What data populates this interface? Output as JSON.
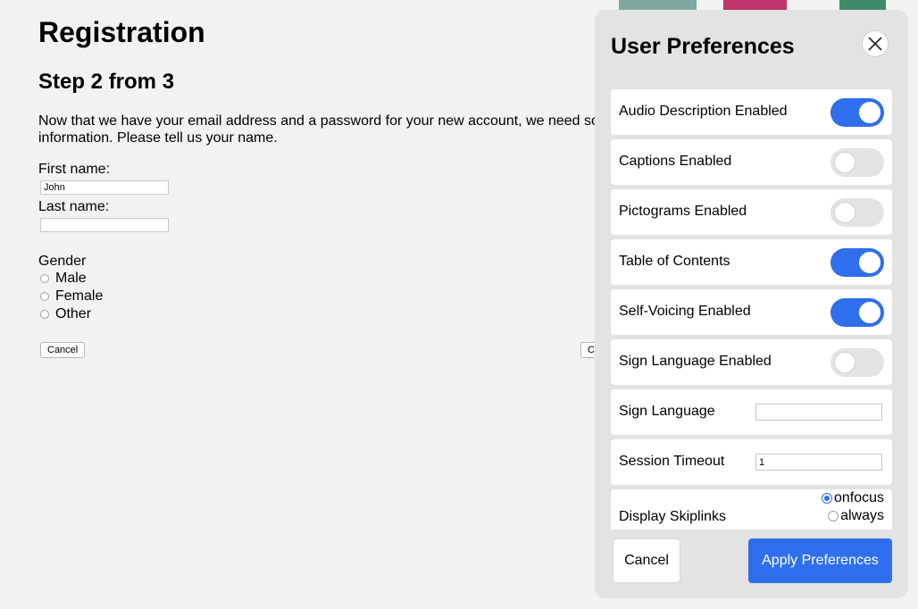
{
  "registration": {
    "title": "Registration",
    "step": "Step 2 from 3",
    "intro_line1": "Now that we have your email address and a password for your new account, we need so",
    "intro_line2": "information. Please tell us your name.",
    "first_name_label": "First name:",
    "first_name_value": "John",
    "last_name_label": "Last name:",
    "last_name_value": "",
    "gender_label": "Gender",
    "gender_options": [
      "Male",
      "Female",
      "Other"
    ],
    "cancel_label": "Cancel",
    "continue_label_partial": "C"
  },
  "preferences": {
    "title": "User Preferences",
    "close_icon": "close-icon",
    "toggles": [
      {
        "label": "Audio Description Enabled",
        "on": true
      },
      {
        "label": "Captions Enabled",
        "on": false
      },
      {
        "label": "Pictograms Enabled",
        "on": false
      },
      {
        "label": "Table of Contents",
        "on": true
      },
      {
        "label": "Self-Voicing Enabled",
        "on": true
      },
      {
        "label": "Sign Language Enabled",
        "on": false
      }
    ],
    "sign_language_label": "Sign Language",
    "sign_language_value": "",
    "session_timeout_label": "Session Timeout",
    "session_timeout_value": "1",
    "skiplinks_label": "Display Skiplinks",
    "skiplinks_options": [
      "onfocus",
      "always"
    ],
    "skiplinks_selected": "onfocus",
    "cancel_label": "Cancel",
    "apply_label": "Apply Preferences"
  },
  "colors": {
    "accent": "#2f6fed",
    "panel_bg": "#e3e3e3",
    "page_bg": "#f2f2f2"
  }
}
